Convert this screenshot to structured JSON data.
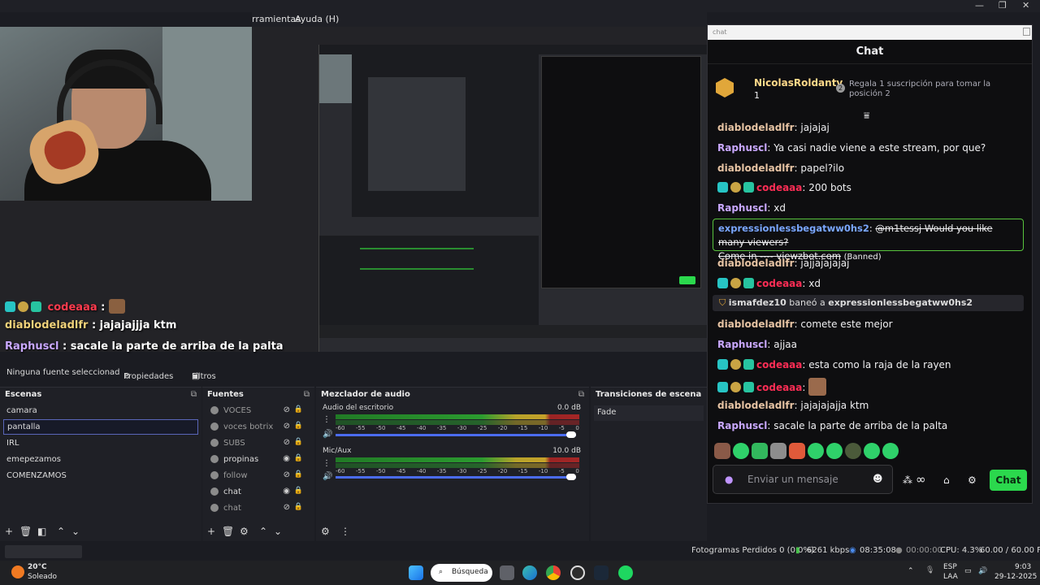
{
  "obs": {
    "menu": {
      "tools": "rramientas",
      "help": "Ayuda (H)"
    },
    "window_controls": {
      "minimize": "—",
      "maximize": "❐",
      "close": "✕"
    },
    "source_toolbar": {
      "no_source": "Ninguna fuente seleccionad",
      "properties": "Propiedades",
      "filters": "Filtros"
    },
    "scenes": {
      "title": "Escenas",
      "items": [
        "camara",
        "pantalla",
        "IRL",
        "emepezamos",
        "COMENZAMOS"
      ],
      "selected": "pantalla"
    },
    "sources": {
      "title": "Fuentes",
      "items": [
        {
          "name": "VOCES",
          "visible": false
        },
        {
          "name": "voces botrix",
          "visible": false
        },
        {
          "name": "SUBS",
          "visible": false
        },
        {
          "name": "propinas",
          "visible": true
        },
        {
          "name": "follow",
          "visible": false
        },
        {
          "name": "chat",
          "visible": true
        },
        {
          "name": "chat",
          "visible": false
        }
      ]
    },
    "mixer": {
      "title": "Mezclador de audio",
      "channels": [
        {
          "name": "Audio del escritorio",
          "db": "0.0 dB",
          "level": 1.0
        },
        {
          "name": "Mic/Aux",
          "db": "10.0 dB",
          "level": 1.0
        }
      ],
      "scale": [
        "-60",
        "-55",
        "-50",
        "-45",
        "-40",
        "-35",
        "-30",
        "-25",
        "-20",
        "-15",
        "-10",
        "-5",
        "0"
      ]
    },
    "transitions": {
      "title": "Transiciones de escena",
      "current": "Fade"
    },
    "status": {
      "dropped": "Fotogramas Perdidos 0 (0.0%)",
      "bitrate": "6261 kbps",
      "stream_time": "08:35:08",
      "rec_time": "00:00:00",
      "cpu": "CPU: 4.3%",
      "fps": "60.00 / 60.00 FPS"
    }
  },
  "overlay_chat": [
    {
      "user": "codeaaa",
      "msg": ":"
    },
    {
      "user": "diablodeladlfr",
      "msg": ": jajajajjja ktm"
    },
    {
      "user": "Raphuscl",
      "msg": ": sacale la parte de arriba de la palta"
    }
  ],
  "chat": {
    "address": "chat",
    "header": "Chat",
    "pinned": {
      "user": "NicolasRoldantv",
      "count": "1",
      "rank": "2",
      "text_line1": "Regala 1 suscripción para tomar la",
      "text_line2": "posición 2"
    },
    "messages": [
      {
        "user": "diablodeladlfr",
        "text": "jajajaj"
      },
      {
        "user": "Raphuscl",
        "text": "Ya casi nadie viene a este stream, por que?"
      },
      {
        "user": "diablodeladlfr",
        "text": "papel?ilo"
      },
      {
        "user": "codeaaa",
        "text": "200 bots"
      },
      {
        "user": "Raphuscl",
        "text": "xd"
      },
      {
        "user": "diablodeladlfr",
        "text": "jajjajajajaj"
      },
      {
        "user": "codeaaa",
        "text": "xd"
      },
      {
        "user": "diablodeladlfr",
        "text": "comete este mejor"
      },
      {
        "user": "Raphuscl",
        "text": "ajjaa"
      },
      {
        "user": "codeaaa",
        "text": "esta como la raja de la rayen"
      },
      {
        "user": "codeaaa",
        "text": ""
      },
      {
        "user": "diablodeladlfr",
        "text": "jajajajajja ktm"
      },
      {
        "user": "Raphuscl",
        "text": "sacale la parte de arriba de la palta"
      }
    ],
    "banned_message": {
      "user": "expressionlessbegatww0hs2",
      "line1": "@m1tessj Would you like many viewers?",
      "line2": "Come in ---- viewzbot.com",
      "tag": "(Banned)"
    },
    "ban_notice": {
      "actor": "ismafdez10",
      "verb": "baneó a",
      "target": "expressionlessbegatww0hs2"
    },
    "input_placeholder": "Enviar un mensaje",
    "send_label": "Chat",
    "infinity": "∞"
  },
  "taskbar": {
    "weather_temp": "20°C",
    "weather_text": "Soleado",
    "search": "Búsqueda",
    "lang": "ESP",
    "lang2": "LAA",
    "time": "9:03",
    "date": "29-12-2025"
  },
  "colors": {
    "accent": "#4b6cf0",
    "twitch_green": "#2bd84d",
    "ban_border": "#58c43d"
  }
}
